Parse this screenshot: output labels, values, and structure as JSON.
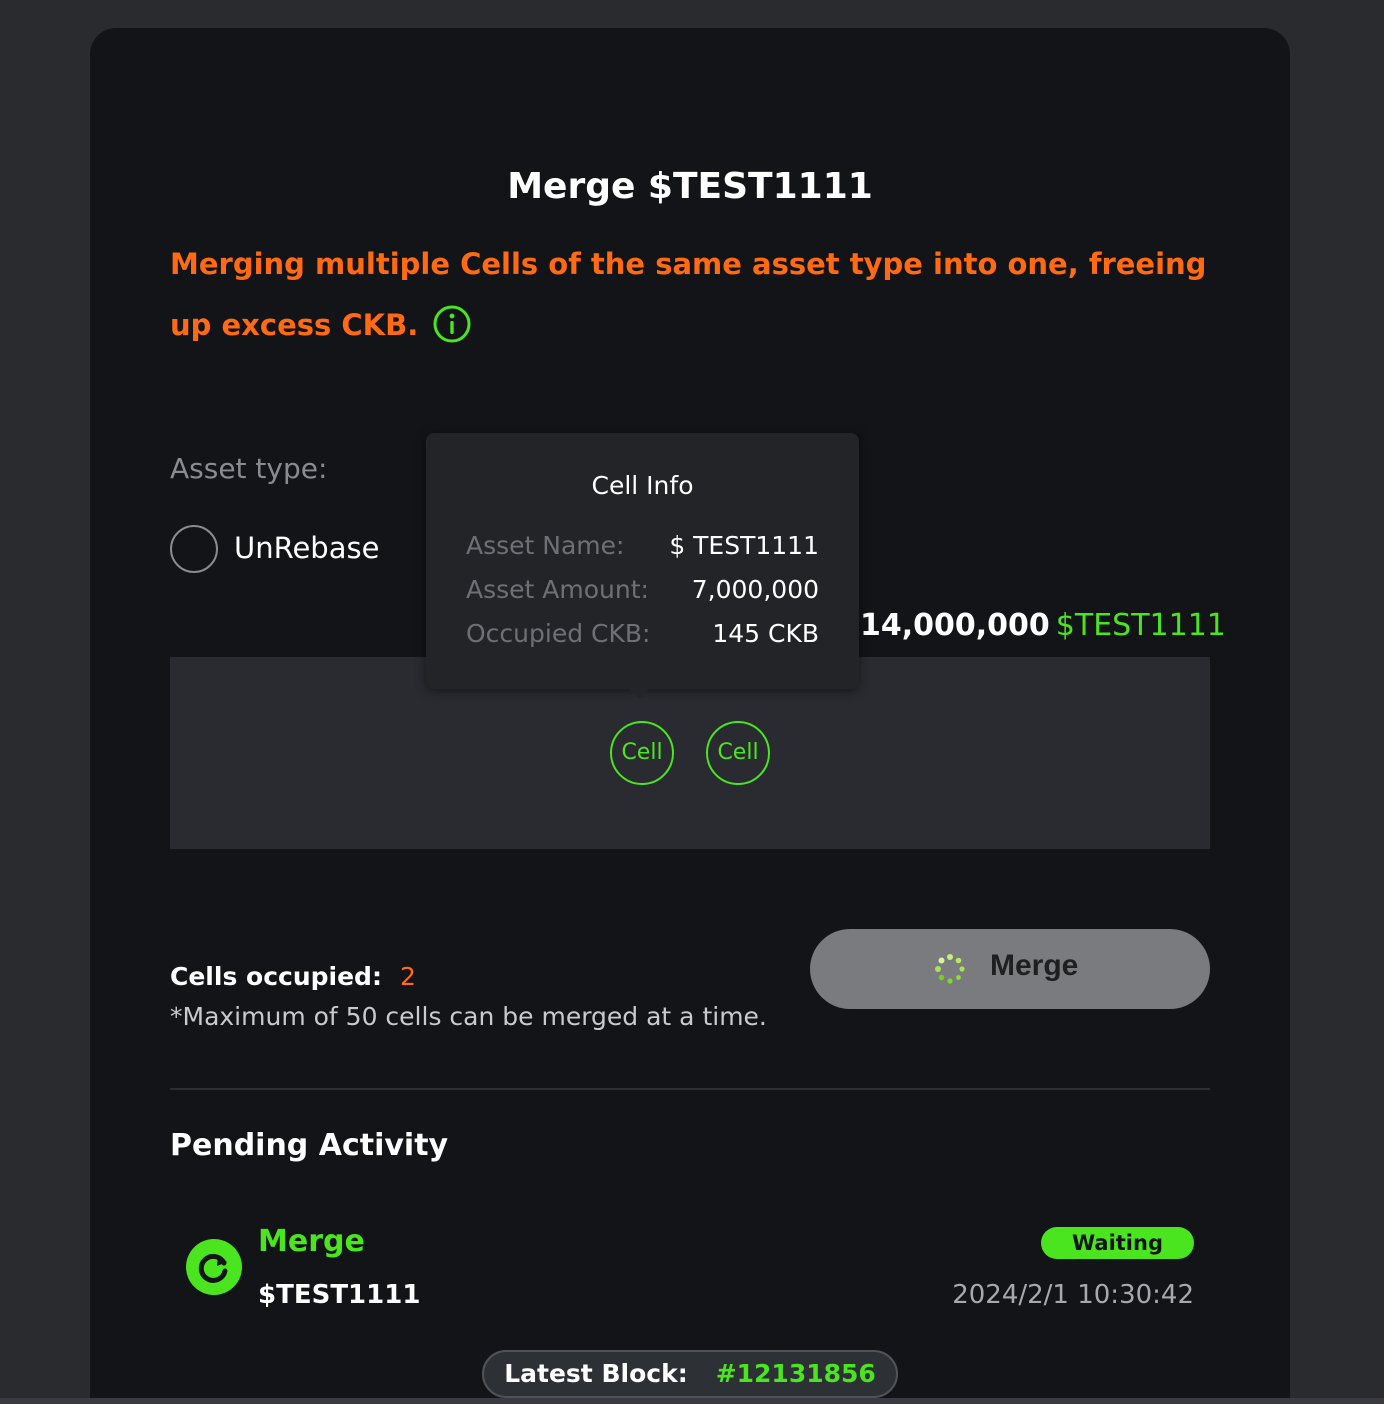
{
  "title": "Merge $TEST1111",
  "description": "Merging multiple Cells of the same asset type into one, freeing up excess CKB.",
  "asset_type": {
    "label": "Asset type:",
    "option": "UnRebase"
  },
  "total": {
    "amount": "14,000,000",
    "symbol": "$TEST1111"
  },
  "cells": [
    {
      "label": "Cell"
    },
    {
      "label": "Cell"
    }
  ],
  "tooltip": {
    "title": "Cell Info",
    "rows": [
      {
        "key": "Asset Name:",
        "value": "$ TEST1111"
      },
      {
        "key": "Asset Amount:",
        "value": "7,000,000"
      },
      {
        "key": "Occupied CKB:",
        "value": "145 CKB"
      }
    ]
  },
  "cells_occupied": {
    "label": "Cells occupied:",
    "value": "2"
  },
  "max_note": "*Maximum of 50 cells can be merged at a time.",
  "merge_button": {
    "label": "Merge"
  },
  "pending": {
    "title": "Pending Activity",
    "items": [
      {
        "name": "Merge",
        "asset": "$TEST1111",
        "status": "Waiting",
        "time": "2024/2/1 10:30:42"
      }
    ]
  },
  "latest_block": {
    "label": "Latest Block:",
    "value": "#12131856"
  },
  "colors": {
    "accent_green": "#4be51f",
    "accent_orange": "#ff6a13",
    "panel_bg": "#131417",
    "page_bg": "#2a2b2f"
  },
  "icons": [
    "info-icon",
    "spinner-icon",
    "refresh-icon"
  ]
}
